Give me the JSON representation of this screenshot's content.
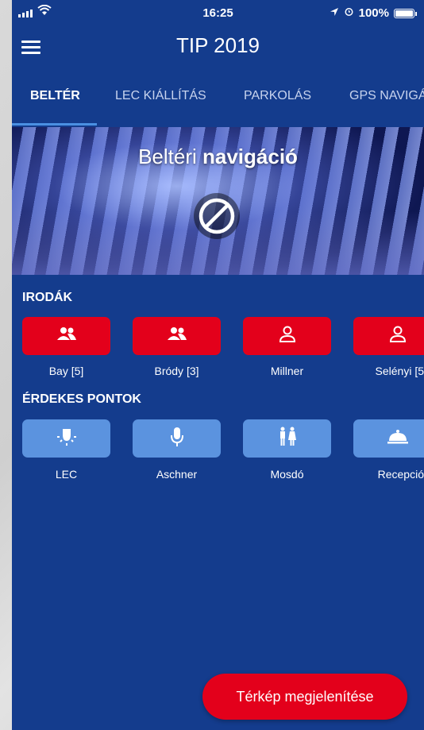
{
  "status_bar": {
    "time": "16:25",
    "battery": "100%"
  },
  "header": {
    "title": "TIP 2019"
  },
  "tabs": [
    {
      "label": "BELTÉR"
    },
    {
      "label": "LEC KIÁLLÍTÁS"
    },
    {
      "label": "PARKOLÁS"
    },
    {
      "label": "GPS NAVIGÁ"
    }
  ],
  "banner": {
    "title_regular": "Beltéri",
    "title_bold": "navigáció"
  },
  "offices": {
    "title": "IRODÁK",
    "items": [
      {
        "label": "Bay [5]",
        "icon": "people-icon"
      },
      {
        "label": "Bródy [3]",
        "icon": "people-icon"
      },
      {
        "label": "Millner",
        "icon": "person-icon"
      },
      {
        "label": "Selényi [5",
        "icon": "person-icon"
      }
    ]
  },
  "points": {
    "title": "ÉRDEKES PONTOK",
    "items": [
      {
        "label": "LEC",
        "icon": "lightbulb-icon"
      },
      {
        "label": "Aschner",
        "icon": "microphone-icon"
      },
      {
        "label": "Mosdó",
        "icon": "restroom-icon"
      },
      {
        "label": "Recepció",
        "icon": "bell-icon"
      }
    ]
  },
  "map_button": {
    "label": "Térkép megjelenítése"
  },
  "colors": {
    "background": "#143c8d",
    "red": "#e3001b",
    "light_blue": "#5b93df",
    "tab_indicator": "#4a90e2"
  }
}
